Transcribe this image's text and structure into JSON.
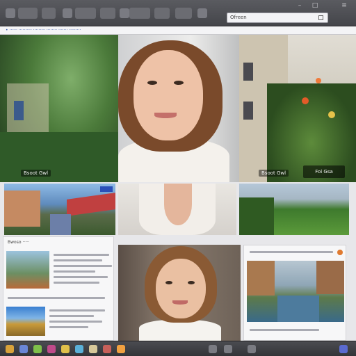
{
  "toolbar": {
    "buttons": [
      "",
      "",
      "",
      "",
      "",
      "",
      ""
    ],
    "address": "Ofreen"
  },
  "bookmarks_text": "• ······ ·········· ········· ········ ······· ·········",
  "tiles": {
    "top_left_caption": "Bsoot Gwl",
    "top_right_caption": "Bsoot Gwl",
    "top_right_caption2": "Foi Gsa",
    "mid_left_badge": "",
    "bottom_left_header": "Bwoso ·····"
  },
  "colors": {
    "toolbar": "#48494e",
    "bookmark_link": "#3355aa",
    "taskbar": "#3c3d42"
  },
  "icons": [
    "back-icon",
    "forward-icon",
    "reload-icon",
    "home-icon",
    "star-icon",
    "menu-icon"
  ]
}
